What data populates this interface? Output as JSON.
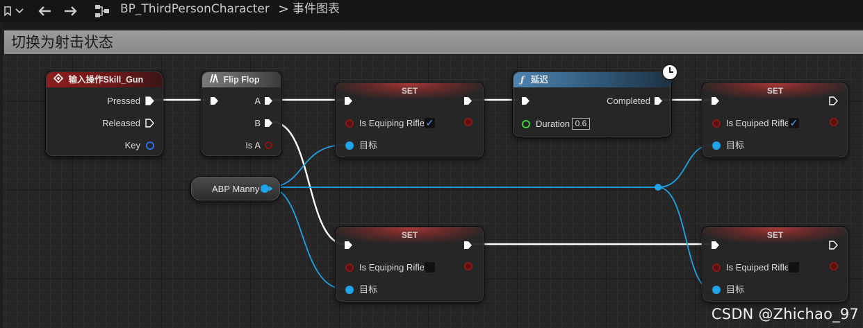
{
  "breadcrumb": {
    "blueprint_name": "BP_ThirdPersonCharacter",
    "separator": ">",
    "graph_name": "事件图表"
  },
  "graph": {
    "comment_title": "切换为射击状态"
  },
  "nodes": {
    "input_action": {
      "title": "输入操作Skill_Gun",
      "pins": {
        "pressed": "Pressed",
        "released": "Released",
        "key": "Key"
      }
    },
    "flip_flop": {
      "title": "Flip Flop",
      "pins": {
        "a": "A",
        "b": "B",
        "is_a": "Is A"
      }
    },
    "set_1": {
      "title": "SET",
      "var_label": "Is Equiping Rifle",
      "checked": true,
      "target_label": "目标"
    },
    "delay": {
      "title": "延迟",
      "pins": {
        "completed": "Completed",
        "duration": "Duration"
      },
      "duration_value": "0.6"
    },
    "set_2": {
      "title": "SET",
      "var_label": "Is Equiped Rifle",
      "checked": true,
      "target_label": "目标"
    },
    "abp_manny": {
      "label": "ABP Manny"
    },
    "set_3": {
      "title": "SET",
      "var_label": "Is Equiping Rifle",
      "checked": false,
      "target_label": "目标"
    },
    "set_4": {
      "title": "SET",
      "var_label": "Is Equiped Rifle",
      "checked": false,
      "target_label": "目标"
    }
  },
  "icons": {
    "bookmark": "bookmark-icon",
    "back": "arrow-left-icon",
    "forward": "arrow-right-icon",
    "graph": "blueprint-graph-icon",
    "latent": "clock-icon",
    "function": "function-icon",
    "event": "event-diamond-icon",
    "flipflop": "flipflop-icon"
  },
  "colors": {
    "exec_wire": "#ffffff",
    "object_wire": "#1ea4e8",
    "bool_pin": "#8c1717",
    "float_pin": "#3ad33a",
    "key_pin": "#2a6fe0",
    "event_header": "#8c1d1d",
    "function_header": "#4f84b0"
  },
  "watermark": "CSDN @Zhichao_97"
}
